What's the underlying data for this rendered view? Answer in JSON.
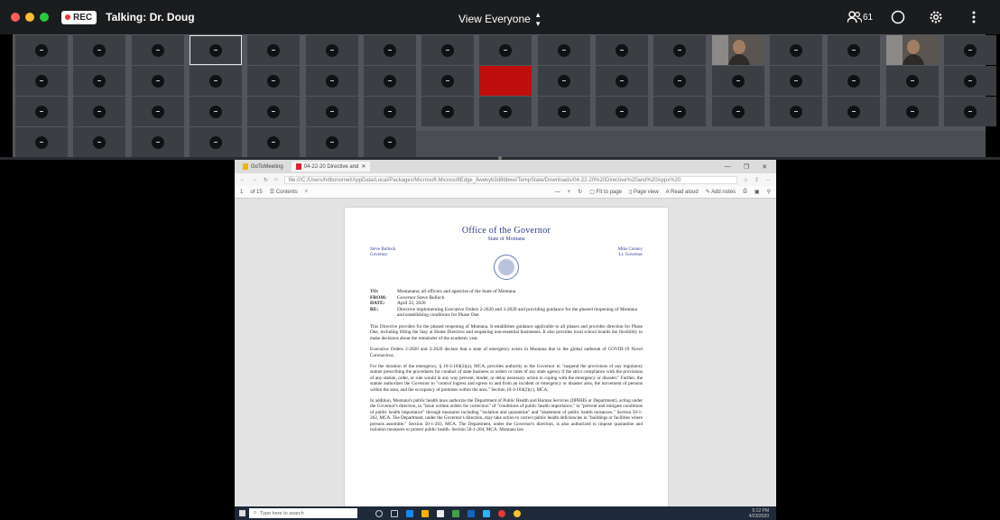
{
  "topbar": {
    "rec_label": "REC",
    "talking": "Talking: Dr. Doug",
    "view_label": "View Everyone",
    "participant_count": "61",
    "icons": [
      "participants-icon",
      "chat-bubble-icon",
      "gear-icon",
      "more-icon"
    ]
  },
  "gallery": {
    "selected_tile": 3,
    "red_tile": 25,
    "video_tiles": [
      12,
      15
    ]
  },
  "browser": {
    "tabs": [
      {
        "label": "GoToMeeting"
      },
      {
        "label": "04-22-20 Directive and"
      }
    ],
    "url": "file:///C:/Users/hdbonomel/AppData/Local/Packages/Microsoft.MicrosoftEdge_8wekyb3d8bbwe/TempState/Downloads/04-22-20%20Directive%20and%20Appx%20",
    "pdf_toolbar": {
      "page": "1",
      "of": "of 15",
      "contents": "Contents",
      "fit": "Fit to page",
      "page_view": "Page view",
      "read_aloud": "Read aloud",
      "add_notes": "Add notes"
    }
  },
  "document": {
    "title": "Office of the Governor",
    "state": "State of Montana",
    "left_name": "Steve Bullock",
    "left_role": "Governor",
    "right_name": "Mike Cooney",
    "right_role": "Lt. Governor",
    "memo": [
      {
        "k": "TO:",
        "v": "Montanans; all officers and agencies of the State of Montana"
      },
      {
        "k": "FROM:",
        "v": "Governor Steve Bullock"
      },
      {
        "k": "DATE:",
        "v": "April 22, 2020"
      },
      {
        "k": "RE:",
        "v": "Directive implementing Executive Orders 2-2020 and 3-2020 and providing guidance for the phased reopening of Montana and establishing conditions for Phase One"
      }
    ],
    "paragraphs": [
      "This Directive provides for the phased reopening of Montana. It establishes guidance applicable to all phases and provides direction for Phase One, including lifting the Stay at Home Directive and reopening non-essential businesses. It also provides local school boards the flexibility to make decisions about the remainder of the academic year.",
      "Executive Orders 2-2020 and 3-2020 declare that a state of emergency exists in Montana due to the global outbreak of COVID-19 Novel Coronavirus.",
      "For the duration of the emergency, § 10-3-104(2)(a), MCA, provides authority to the Governor to \"suspend the provisions of any regulatory statute prescribing the procedures for conduct of state business or orders or rules of any state agency if the strict compliance with the provisions of any statute, order, or rule would in any way prevent, hinder, or delay necessary action in coping with the emergency or disaster.\" Further, the statute authorizes the Governor to \"control ingress and egress to and from an incident or emergency or disaster area, the movement of persons within the area, and the occupancy of premises within the area.\" Section 10-3-104(2)(c), MCA.",
      "In addition, Montana's public health laws authorize the Department of Public Health and Human Services (DPHHS or Department), acting under the Governor's direction, to \"issue written orders for correction\" of \"conditions of public health importance,\" to \"prevent and mitigate conditions of public health importance\" through measures including \"isolation and quarantine\" and \"abatement of public health nuisances.\" Section 50-1-202, MCA. The Department, under the Governor's direction, may take action to correct public health deficiencies in \"buildings or facilities where persons assemble.\" Section 50-1-203, MCA. The Department, under the Governor's direction, is also authorized to impose quarantine and isolation measures to protect public health. Section 50-1-204, MCA. Montana law"
    ]
  },
  "taskbar": {
    "search_placeholder": "Type here to search",
    "time": "5:12 PM",
    "date": "4/23/2020"
  }
}
